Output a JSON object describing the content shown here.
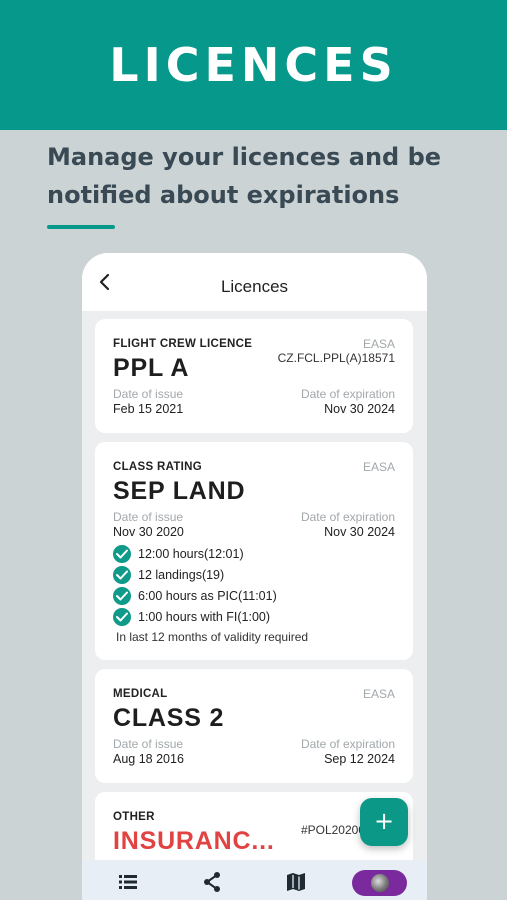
{
  "banner": {
    "title": "LICENCES"
  },
  "tagline": {
    "text": "Manage your licences and be notified about expirations"
  },
  "appbar": {
    "title": "Licences",
    "back_icon": "chevron-left-icon"
  },
  "cards": [
    {
      "type": "FLIGHT CREW LICENCE",
      "authority": "EASA",
      "number": "CZ.FCL.PPL(A)18571",
      "name": "PPL A",
      "issue_label": "Date of issue",
      "issue_value": "Feb 15 2021",
      "expiration_label": "Date of expiration",
      "expiration_value": "Nov 30 2024"
    },
    {
      "type": "CLASS RATING",
      "authority": "EASA",
      "name": "SEP LAND",
      "issue_label": "Date of issue",
      "issue_value": "Nov 30 2020",
      "expiration_label": "Date of expiration",
      "expiration_value": "Nov 30 2024",
      "requirements": [
        {
          "text": "12:00 hours(12:01)"
        },
        {
          "text": "12 landings(19)"
        },
        {
          "text": "6:00 hours as PIC(11:01)"
        },
        {
          "text": "1:00 hours with FI(1:00)"
        }
      ],
      "requirements_note": "In last 12 months of validity required"
    },
    {
      "type": "MEDICAL",
      "authority": "EASA",
      "name": "CLASS 2",
      "issue_label": "Date of issue",
      "issue_value": "Aug 18 2016",
      "expiration_label": "Date of expiration",
      "expiration_value": "Sep 12 2024"
    },
    {
      "type": "OTHER",
      "number": "#POL20200",
      "name": "INSURANC..."
    }
  ],
  "fab": {
    "label": "+"
  },
  "bottom_nav": {
    "items": [
      "list-icon",
      "share-icon",
      "map-icon",
      "avatar"
    ]
  },
  "colors": {
    "brand": "#06988a",
    "background": "#ccd3d5",
    "heading": "#394a55",
    "alert": "#e14242",
    "avatar_pill": "#7a2a9c"
  }
}
